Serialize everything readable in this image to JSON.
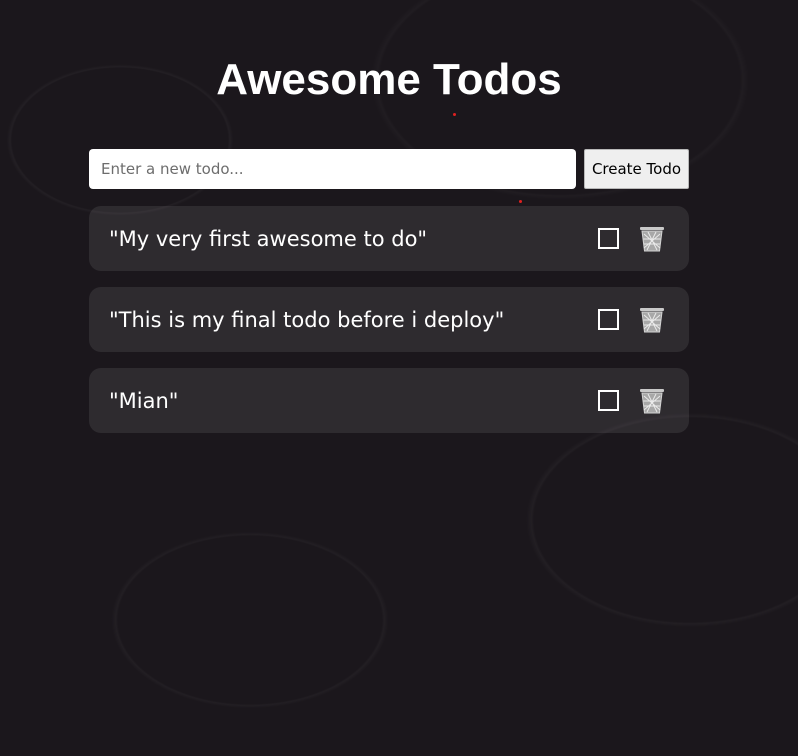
{
  "app": {
    "title": "Awesome Todos"
  },
  "form": {
    "placeholder": "Enter a new todo...",
    "value": "",
    "create_label": "Create Todo"
  },
  "todos": [
    {
      "text": "\"My very first awesome to do\"",
      "checked": false
    },
    {
      "text": "\"This is my final todo before i deploy\"",
      "checked": false
    },
    {
      "text": "\"Mian\"",
      "checked": false
    }
  ],
  "icons": {
    "checkbox": "checkbox-icon",
    "delete": "trash-icon"
  },
  "colors": {
    "background": "#1b171c",
    "card": "rgba(255,255,255,0.085)",
    "text": "#ffffff",
    "accent_dot": "#e02020"
  }
}
